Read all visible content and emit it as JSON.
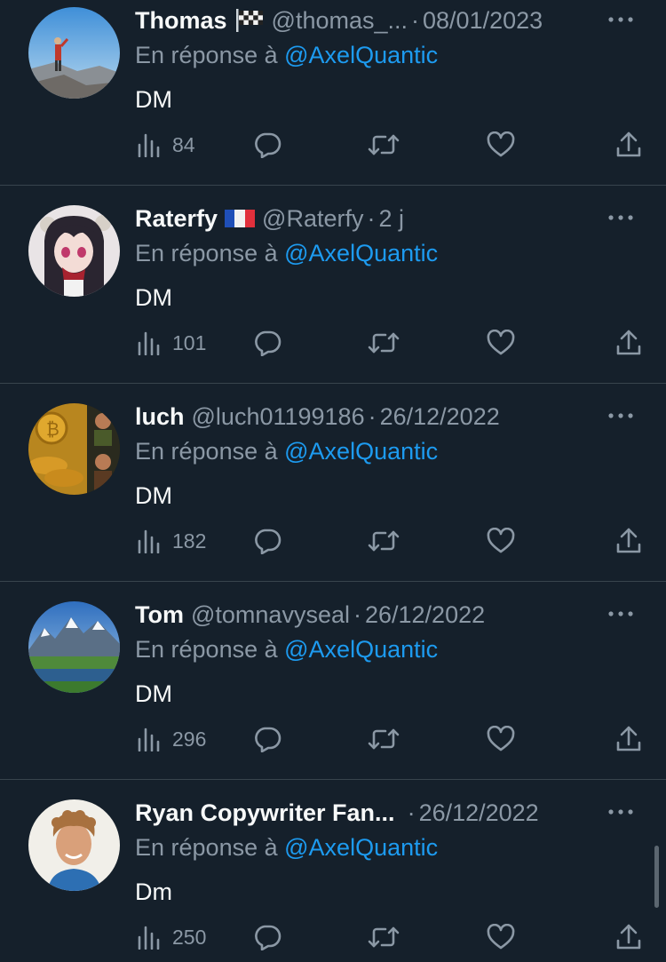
{
  "reply_prefix": "En réponse à",
  "tweets": [
    {
      "name": "Thomas",
      "badge_icon": "checkered-flag-icon",
      "handle": "@thomas_...",
      "separator": "·",
      "date": "08/01/2023",
      "mention": "@AxelQuantic",
      "text": "DM",
      "views": "84"
    },
    {
      "name": "Raterfy",
      "badge_icon": "france-flag-icon",
      "handle": "@Raterfy",
      "separator": "·",
      "date": "2 j",
      "mention": "@AxelQuantic",
      "text": "DM",
      "views": "101"
    },
    {
      "name": "luch",
      "handle": "@luch01199186",
      "separator": "·",
      "date": "26/12/2022",
      "mention": "@AxelQuantic",
      "text": "DM",
      "views": "182"
    },
    {
      "name": "Tom",
      "handle": "@tomnavyseal",
      "separator": "·",
      "date": "26/12/2022",
      "mention": "@AxelQuantic",
      "text": "DM",
      "views": "296"
    },
    {
      "name": "Ryan Copywriter Fan...",
      "handle": "",
      "separator": "·",
      "date": "26/12/2022",
      "mention": "@AxelQuantic",
      "text": "Dm",
      "views": "250"
    }
  ],
  "colors": {
    "background": "#15202b",
    "divider": "#38444d",
    "secondary_text": "#8b98a5",
    "link": "#1d9bf0",
    "primary_text": "#f7f9f9"
  }
}
